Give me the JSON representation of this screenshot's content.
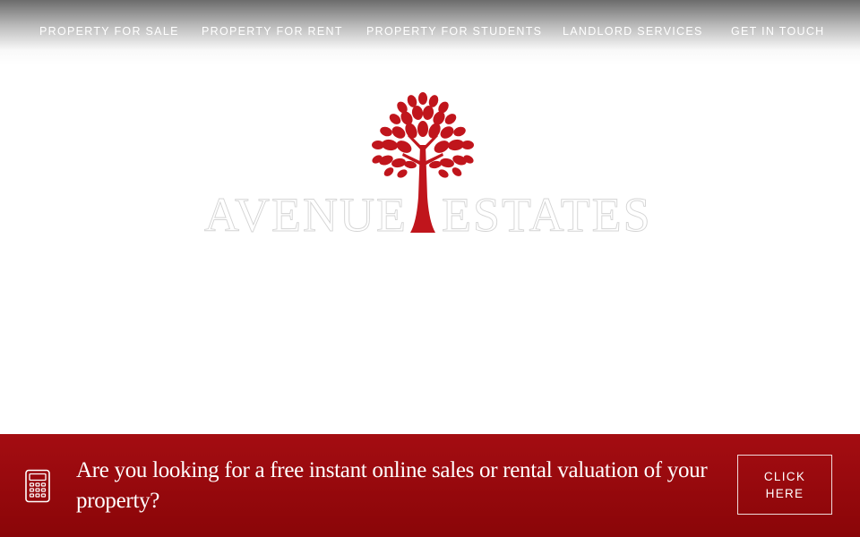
{
  "nav": {
    "items": [
      {
        "label": "PROPERTY FOR SALE"
      },
      {
        "label": "PROPERTY FOR RENT"
      },
      {
        "label": "PROPERTY FOR STUDENTS"
      },
      {
        "label": "LANDLORD SERVICES"
      },
      {
        "label": "GET IN TOUCH"
      }
    ]
  },
  "logo": {
    "word_left": "AVENUE",
    "word_right": "ESTATES",
    "tree_color": "#c0151c"
  },
  "banner": {
    "icon": "calculator-icon",
    "text": "Are you looking for a free instant online sales or rental valuation of your property?",
    "cta_label": "CLICK HERE",
    "background": "#8f080c"
  },
  "colors": {
    "accent": "#c0151c",
    "banner_red": "#8f080c",
    "text_light": "#ffffff"
  }
}
